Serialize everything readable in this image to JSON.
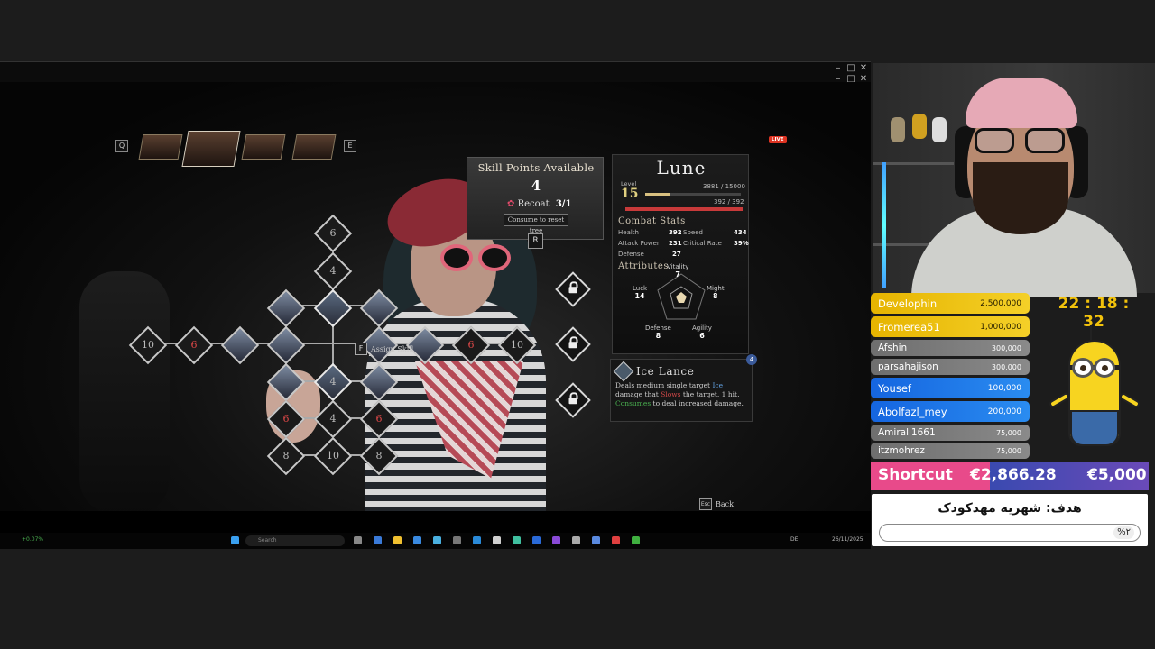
{
  "window_controls": [
    "–",
    "□",
    "✕"
  ],
  "party": {
    "prev_key": "Q",
    "next_key": "E"
  },
  "skill_points": {
    "title": "Skill Points Available",
    "count": "4",
    "recoat_label": "Recoat",
    "recoat_value": "3/1",
    "consume_label": "Consume to reset tree",
    "reset_key": "R"
  },
  "skill_tree": {
    "nodes": [
      "6",
      "4",
      "10",
      "6",
      "6",
      "10",
      "4",
      "6",
      "4",
      "6",
      "8",
      "10",
      "8"
    ],
    "assign_key": "F",
    "assign_label": "Assign Skill"
  },
  "character": {
    "name": "Lune",
    "level_label": "Level",
    "level": "15",
    "xp": "3881 / 15000",
    "xp_fraction": 0.26,
    "hp": "392 / 392",
    "hp_fraction": 1.0,
    "combat_title": "Combat Stats",
    "stats": [
      {
        "label": "Health",
        "value": "392"
      },
      {
        "label": "Speed",
        "value": "434"
      },
      {
        "label": "Attack Power",
        "value": "231"
      },
      {
        "label": "Critical Rate",
        "value": "39%"
      },
      {
        "label": "Defense",
        "value": "27"
      }
    ],
    "attributes_title": "Attributes",
    "attributes": [
      {
        "label": "Vitality",
        "value": "7"
      },
      {
        "label": "Luck",
        "value": "14"
      },
      {
        "label": "Might",
        "value": "8"
      },
      {
        "label": "Defense",
        "value": "8"
      },
      {
        "label": "Agility",
        "value": "6"
      }
    ]
  },
  "ability": {
    "name": "Ice Lance",
    "badge": "4",
    "desc_a": "Deals medium single target ",
    "desc_ice": "Ice",
    "desc_b": " damage that ",
    "desc_slow": "Slows",
    "desc_c": " the target. 1 hit. ",
    "desc_con": "Consumes",
    "desc_d": " to deal increased damage."
  },
  "back": {
    "key": "Esc",
    "label": "Back"
  },
  "live": "LIVE",
  "taskbar": {
    "search": "Search",
    "stat_left": "+0.07%",
    "lang": "DE",
    "date": "26/11/2025"
  },
  "stream": {
    "timer": "22 : 18 : 32",
    "donations": [
      {
        "name": "Develophin",
        "amount": "2,500,000",
        "tier": "gold"
      },
      {
        "name": "Fromerea51",
        "amount": "1,000,000",
        "tier": "gold"
      },
      {
        "name": "Afshin",
        "amount": "300,000",
        "tier": "grey"
      },
      {
        "name": "parsahajison",
        "amount": "300,000",
        "tier": "grey"
      },
      {
        "name": "Yousef",
        "amount": "100,000",
        "tier": "blue"
      },
      {
        "name": "Abolfazl_mey",
        "amount": "200,000",
        "tier": "blue"
      },
      {
        "name": "Amirali1661",
        "amount": "75,000",
        "tier": "grey"
      },
      {
        "name": "itzmohrez",
        "amount": "75,000",
        "tier": "grey"
      }
    ],
    "goal": {
      "label": "Shortcut",
      "current": "€2,866.28",
      "total": "€5,000",
      "title": "هدف: شهریه مهدکودک",
      "percent": "%۲",
      "fraction": 0.02
    }
  }
}
